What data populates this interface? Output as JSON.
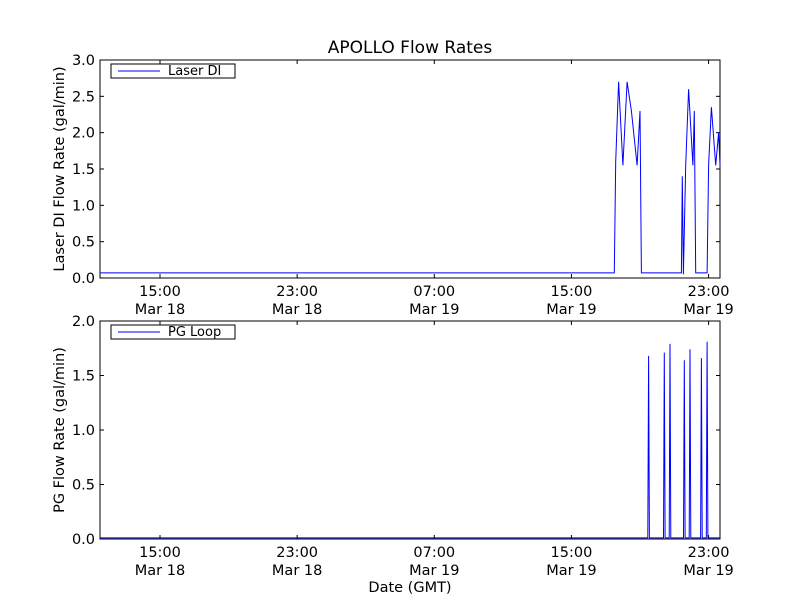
{
  "chart_data": [
    {
      "type": "line",
      "title": "APOLLO Flow Rates",
      "xlabel": "",
      "ylabel": "Laser DI Flow Rate (gal/min)",
      "x_unit": "GMT",
      "xlim": [
        "2010-03-18 11:30",
        "2010-03-19 23:40"
      ],
      "ylim": [
        0,
        3.0
      ],
      "yticks": [
        0.0,
        0.5,
        1.0,
        1.5,
        2.0,
        2.5,
        3.0
      ],
      "yticklabels": [
        "0.0",
        "0.5",
        "1.0",
        "1.5",
        "2.0",
        "2.5",
        "3.0"
      ],
      "xticks": [
        "2010-03-18 15:00",
        "2010-03-18 23:00",
        "2010-03-19 07:00",
        "2010-03-19 15:00",
        "2010-03-19 23:00"
      ],
      "xticklabels": [
        [
          "15:00",
          "Mar 18"
        ],
        [
          "23:00",
          "Mar 18"
        ],
        [
          "07:00",
          "Mar 19"
        ],
        [
          "15:00",
          "Mar 19"
        ],
        [
          "23:00",
          "Mar 19"
        ]
      ],
      "grid": false,
      "legend": {
        "placement": "top-left"
      },
      "series": [
        {
          "name": "Laser DI",
          "color": "#0000ff",
          "points": [
            [
              "2010-03-18 11:30",
              0.07
            ],
            [
              "2010-03-19 17:30",
              0.07
            ],
            [
              "2010-03-19 17:35",
              1.6
            ],
            [
              "2010-03-19 17:45",
              2.7
            ],
            [
              "2010-03-19 18:00",
              1.55
            ],
            [
              "2010-03-19 18:15",
              2.7
            ],
            [
              "2010-03-19 18:30",
              2.3
            ],
            [
              "2010-03-19 18:50",
              1.55
            ],
            [
              "2010-03-19 19:00",
              2.3
            ],
            [
              "2010-03-19 19:05",
              0.07
            ],
            [
              "2010-03-19 21:25",
              0.07
            ],
            [
              "2010-03-19 21:28",
              1.4
            ],
            [
              "2010-03-19 21:32",
              0.05
            ],
            [
              "2010-03-19 21:40",
              1.55
            ],
            [
              "2010-03-19 21:50",
              2.6
            ],
            [
              "2010-03-19 22:05",
              1.55
            ],
            [
              "2010-03-19 22:10",
              2.3
            ],
            [
              "2010-03-19 22:15",
              0.07
            ],
            [
              "2010-03-19 22:55",
              0.07
            ],
            [
              "2010-03-19 23:00",
              1.55
            ],
            [
              "2010-03-19 23:10",
              2.35
            ],
            [
              "2010-03-19 23:25",
              1.55
            ],
            [
              "2010-03-19 23:35",
              2.0
            ],
            [
              "2010-03-19 23:40",
              1.55
            ]
          ]
        }
      ]
    },
    {
      "type": "line",
      "title": "",
      "xlabel": "Date (GMT)",
      "ylabel": "PG Flow Rate (gal/min)",
      "x_unit": "GMT",
      "xlim": [
        "2010-03-18 11:30",
        "2010-03-19 23:40"
      ],
      "ylim": [
        0,
        2.0
      ],
      "yticks": [
        0.0,
        0.5,
        1.0,
        1.5,
        2.0
      ],
      "yticklabels": [
        "0.0",
        "0.5",
        "1.0",
        "1.5",
        "2.0"
      ],
      "xticks": [
        "2010-03-18 15:00",
        "2010-03-18 23:00",
        "2010-03-19 07:00",
        "2010-03-19 15:00",
        "2010-03-19 23:00"
      ],
      "xticklabels": [
        [
          "15:00",
          "Mar 18"
        ],
        [
          "23:00",
          "Mar 18"
        ],
        [
          "07:00",
          "Mar 19"
        ],
        [
          "15:00",
          "Mar 19"
        ],
        [
          "23:00",
          "Mar 19"
        ]
      ],
      "grid": false,
      "legend": {
        "placement": "top-left"
      },
      "series": [
        {
          "name": "PG Loop",
          "color": "#0000ff",
          "baseline": 0.01,
          "spikes": [
            [
              "2010-03-19 19:30",
              1.68
            ],
            [
              "2010-03-19 20:25",
              1.71
            ],
            [
              "2010-03-19 20:45",
              1.79
            ],
            [
              "2010-03-19 21:35",
              1.64
            ],
            [
              "2010-03-19 21:55",
              1.74
            ],
            [
              "2010-03-19 22:35",
              1.66
            ],
            [
              "2010-03-19 22:55",
              1.81
            ]
          ]
        }
      ]
    }
  ]
}
